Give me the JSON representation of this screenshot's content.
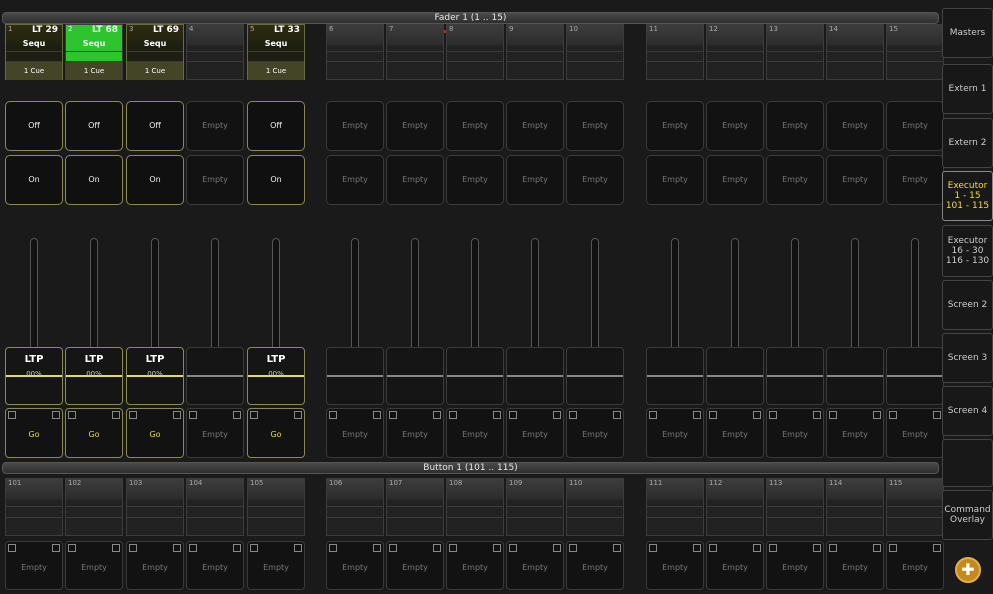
{
  "fader_bar": {
    "title": "Fader  1 (1 .. 15)"
  },
  "button_bar": {
    "title": "Button  1 (101 .. 115)"
  },
  "executors": [
    {
      "num": "1",
      "name": "LT 29",
      "seq": "Sequ",
      "cue": "1 Cue",
      "top": "Off",
      "bottom": "On",
      "ltp": "LTP",
      "pct": "00%",
      "go": "Go",
      "state": "active"
    },
    {
      "num": "2",
      "name": "LT 68",
      "seq": "Sequ",
      "cue": "1 Cue",
      "top": "Off",
      "bottom": "On",
      "ltp": "LTP",
      "pct": "00%",
      "go": "Go",
      "state": "green"
    },
    {
      "num": "3",
      "name": "LT 69",
      "seq": "Sequ",
      "cue": "1 Cue",
      "top": "Off",
      "bottom": "On",
      "ltp": "LTP",
      "pct": "00%",
      "go": "Go",
      "state": "active"
    },
    {
      "num": "4",
      "name": "",
      "seq": "",
      "cue": "",
      "top": "Empty",
      "bottom": "Empty",
      "ltp": "",
      "pct": "",
      "go": "Empty",
      "state": "empty"
    },
    {
      "num": "5",
      "name": "LT 33",
      "seq": "Sequ",
      "cue": "1 Cue",
      "top": "Off",
      "bottom": "On",
      "ltp": "LTP",
      "pct": "00%",
      "go": "Go",
      "state": "active"
    },
    {
      "num": "6",
      "name": "",
      "seq": "",
      "cue": "",
      "top": "Empty",
      "bottom": "Empty",
      "ltp": "",
      "pct": "",
      "go": "Empty",
      "state": "empty"
    },
    {
      "num": "7",
      "name": "",
      "seq": "",
      "cue": "",
      "top": "Empty",
      "bottom": "Empty",
      "ltp": "",
      "pct": "",
      "go": "Empty",
      "state": "empty"
    },
    {
      "num": "8",
      "name": "",
      "seq": "",
      "cue": "",
      "top": "Empty",
      "bottom": "Empty",
      "ltp": "",
      "pct": "",
      "go": "Empty",
      "state": "empty"
    },
    {
      "num": "9",
      "name": "",
      "seq": "",
      "cue": "",
      "top": "Empty",
      "bottom": "Empty",
      "ltp": "",
      "pct": "",
      "go": "Empty",
      "state": "empty"
    },
    {
      "num": "10",
      "name": "",
      "seq": "",
      "cue": "",
      "top": "Empty",
      "bottom": "Empty",
      "ltp": "",
      "pct": "",
      "go": "Empty",
      "state": "empty"
    },
    {
      "num": "11",
      "name": "",
      "seq": "",
      "cue": "",
      "top": "Empty",
      "bottom": "Empty",
      "ltp": "",
      "pct": "",
      "go": "Empty",
      "state": "empty"
    },
    {
      "num": "12",
      "name": "",
      "seq": "",
      "cue": "",
      "top": "Empty",
      "bottom": "Empty",
      "ltp": "",
      "pct": "",
      "go": "Empty",
      "state": "empty"
    },
    {
      "num": "13",
      "name": "",
      "seq": "",
      "cue": "",
      "top": "Empty",
      "bottom": "Empty",
      "ltp": "",
      "pct": "",
      "go": "Empty",
      "state": "empty"
    },
    {
      "num": "14",
      "name": "",
      "seq": "",
      "cue": "",
      "top": "Empty",
      "bottom": "Empty",
      "ltp": "",
      "pct": "",
      "go": "Empty",
      "state": "empty"
    },
    {
      "num": "15",
      "name": "",
      "seq": "",
      "cue": "",
      "top": "Empty",
      "bottom": "Empty",
      "ltp": "",
      "pct": "",
      "go": "Empty",
      "state": "empty"
    }
  ],
  "buttons": [
    {
      "num": "101",
      "label": "Empty"
    },
    {
      "num": "102",
      "label": "Empty"
    },
    {
      "num": "103",
      "label": "Empty"
    },
    {
      "num": "104",
      "label": "Empty"
    },
    {
      "num": "105",
      "label": "Empty"
    },
    {
      "num": "106",
      "label": "Empty"
    },
    {
      "num": "107",
      "label": "Empty"
    },
    {
      "num": "108",
      "label": "Empty"
    },
    {
      "num": "109",
      "label": "Empty"
    },
    {
      "num": "110",
      "label": "Empty"
    },
    {
      "num": "111",
      "label": "Empty"
    },
    {
      "num": "112",
      "label": "Empty"
    },
    {
      "num": "113",
      "label": "Empty"
    },
    {
      "num": "114",
      "label": "Empty"
    },
    {
      "num": "115",
      "label": "Empty"
    }
  ],
  "sidebar": [
    {
      "label": "Masters",
      "selected": false
    },
    {
      "label": "Extern 1",
      "selected": false
    },
    {
      "label": "Extern 2",
      "selected": false
    },
    {
      "label": "Executor\n1 - 15\n101 - 115",
      "selected": true
    },
    {
      "label": "Executor\n16 - 30\n116 - 130",
      "selected": false
    },
    {
      "label": "Screen 2",
      "selected": false
    },
    {
      "label": "Screen 3",
      "selected": false
    },
    {
      "label": "Screen 4",
      "selected": false
    },
    {
      "label": "",
      "selected": false
    },
    {
      "label": "Command\nOverlay",
      "selected": false
    }
  ],
  "plus_button": {
    "icon": "plus-icon",
    "symbol": "✚"
  }
}
